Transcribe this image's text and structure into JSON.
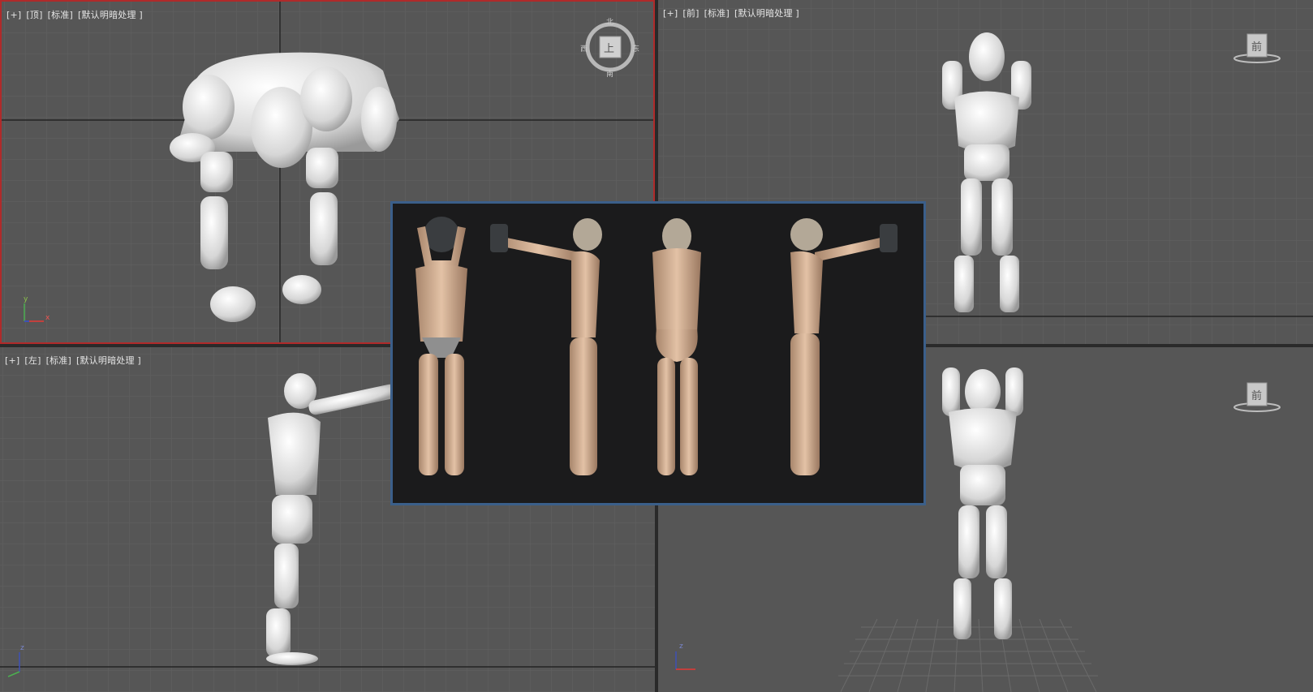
{
  "viewports": {
    "top": {
      "menu": "[+]",
      "view": "[顶]",
      "shading": "[标准]",
      "lighting": "[默认明暗处理 ]",
      "cube_label": "上",
      "cube_n": "北",
      "cube_s": "南",
      "cube_w": "西",
      "cube_e": "东"
    },
    "front": {
      "menu": "[+]",
      "view": "[前]",
      "shading": "[标准]",
      "lighting": "[默认明暗处理 ]",
      "cube_label": "前"
    },
    "left": {
      "menu": "[+]",
      "view": "[左]",
      "shading": "[标准]",
      "lighting": "[默认明暗处理 ]"
    },
    "perspective": {
      "cube_label": "前"
    }
  },
  "axes": {
    "x": "x",
    "y": "y",
    "z": "z"
  },
  "colors": {
    "viewport_bg": "#565656",
    "grid_line": "#616161",
    "axis_line": "#1a1a1a",
    "active_border": "#b02a2a",
    "ref_border": "#3b5f8a"
  }
}
